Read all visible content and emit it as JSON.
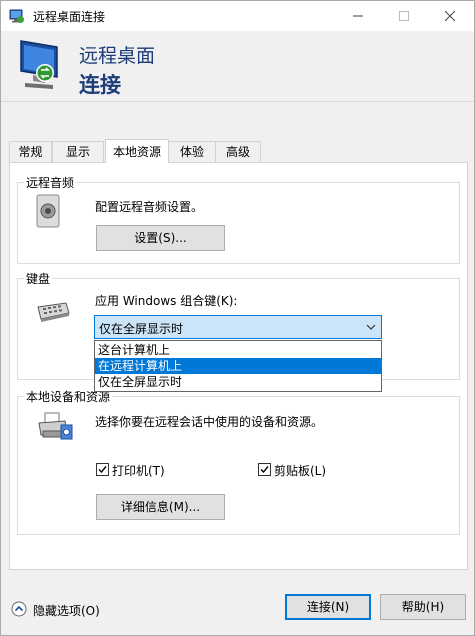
{
  "window": {
    "title": "远程桌面连接"
  },
  "banner": {
    "line1": "远程桌面",
    "line2": "连接"
  },
  "tabs": [
    {
      "label": "常规"
    },
    {
      "label": "显示"
    },
    {
      "label": "本地资源"
    },
    {
      "label": "体验"
    },
    {
      "label": "高级"
    }
  ],
  "audio": {
    "legend": "远程音频",
    "description": "配置远程音频设置。",
    "settings_button": "设置(S)..."
  },
  "keyboard": {
    "legend": "键盘",
    "description": "应用 Windows 组合键(K):",
    "selected": "仅在全屏显示时",
    "options": [
      "这台计算机上",
      "在远程计算机上",
      "仅在全屏显示时"
    ],
    "highlighted_option": "在远程计算机上"
  },
  "local_devices": {
    "legend": "本地设备和资源",
    "description": "选择你要在远程会话中使用的设备和资源。",
    "printer_label": "打印机(T)",
    "printer_checked": true,
    "clipboard_label": "剪贴板(L)",
    "clipboard_checked": true,
    "details_button": "详细信息(M)..."
  },
  "footer": {
    "hide_options": "隐藏选项(O)",
    "connect_button": "连接(N)",
    "help_button": "帮助(H)"
  },
  "colors": {
    "accent": "#0078d7",
    "banner_text": "#1c3d7a"
  }
}
